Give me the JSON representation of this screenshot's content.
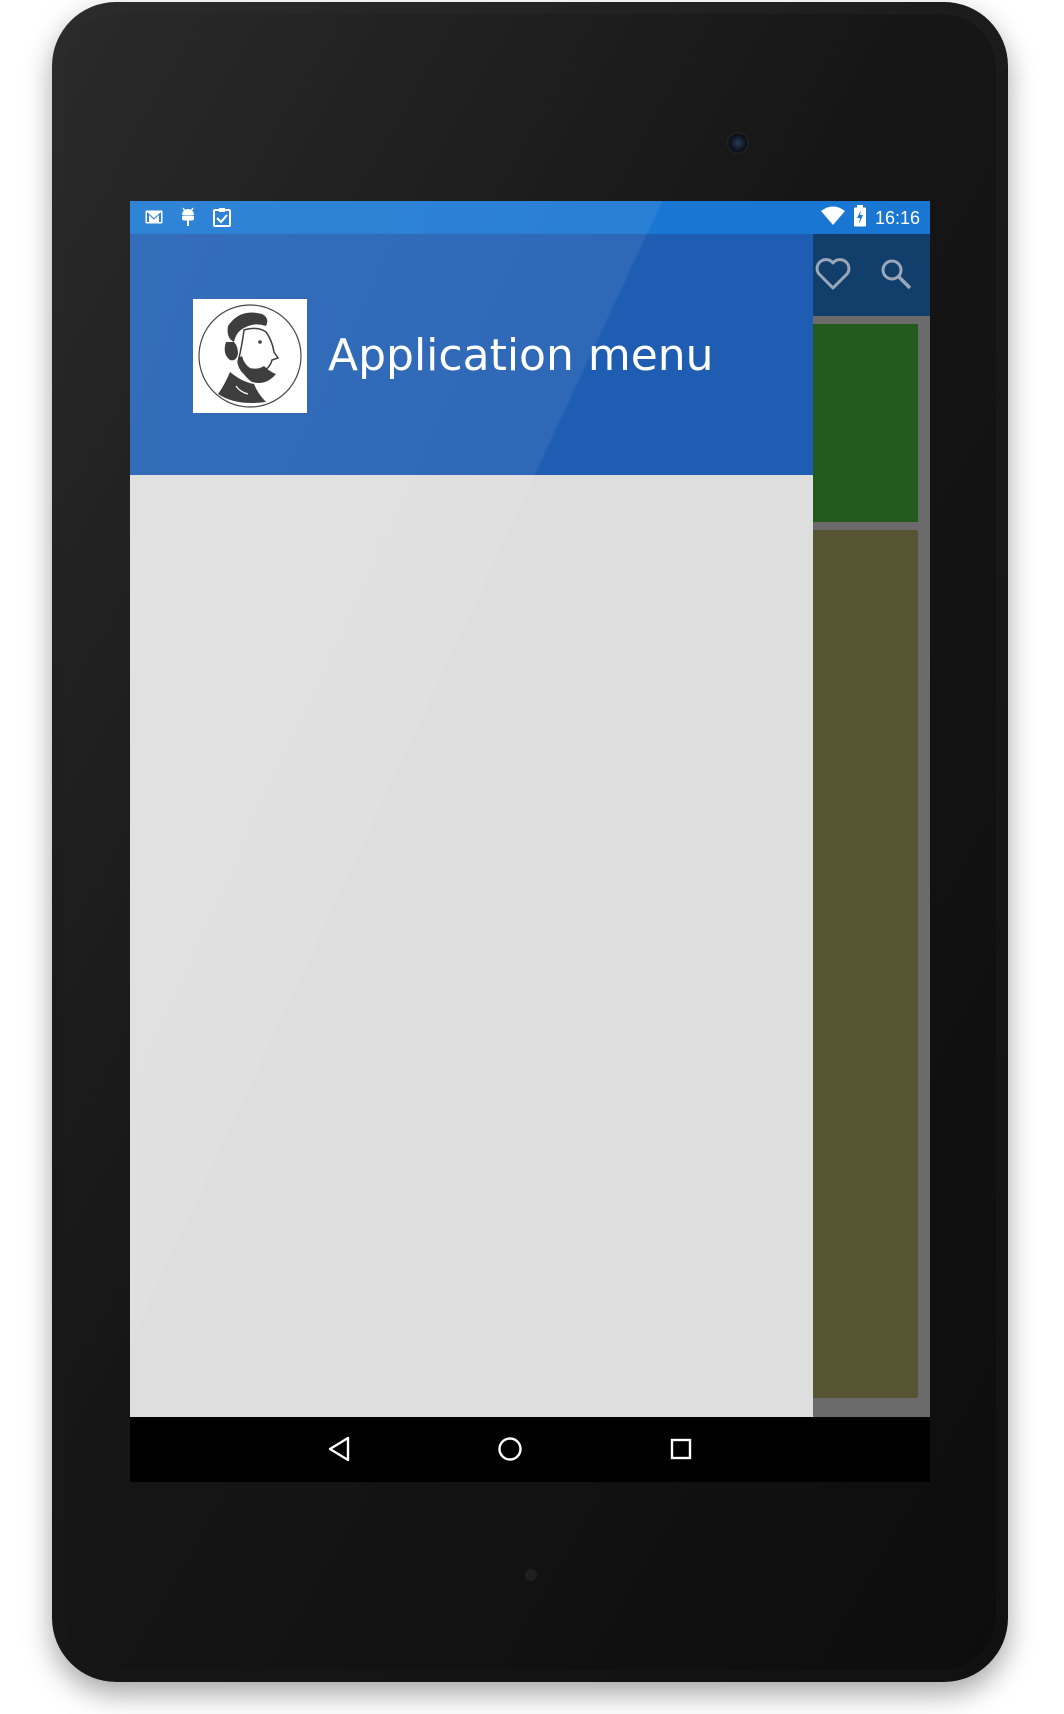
{
  "status_bar": {
    "left_icons": [
      "gmail-icon",
      "android-debug-icon",
      "clipboard-check-icon"
    ],
    "right_icons": [
      "wifi-icon",
      "battery-charging-icon"
    ],
    "time": "16:16",
    "color": "#1976d2"
  },
  "app_toolbar": {
    "actions": [
      "heart-icon",
      "search-icon"
    ]
  },
  "drawer": {
    "header_title": "Application menu",
    "header_color": "#1e5db2",
    "avatar": "bearded-man-avatar",
    "background": "#dedede"
  },
  "content": {
    "cards": [
      {
        "color": "#235a1e"
      },
      {
        "color": "#575531"
      }
    ]
  },
  "nav_bar": {
    "buttons": [
      "back-icon",
      "home-icon",
      "recents-icon"
    ]
  }
}
